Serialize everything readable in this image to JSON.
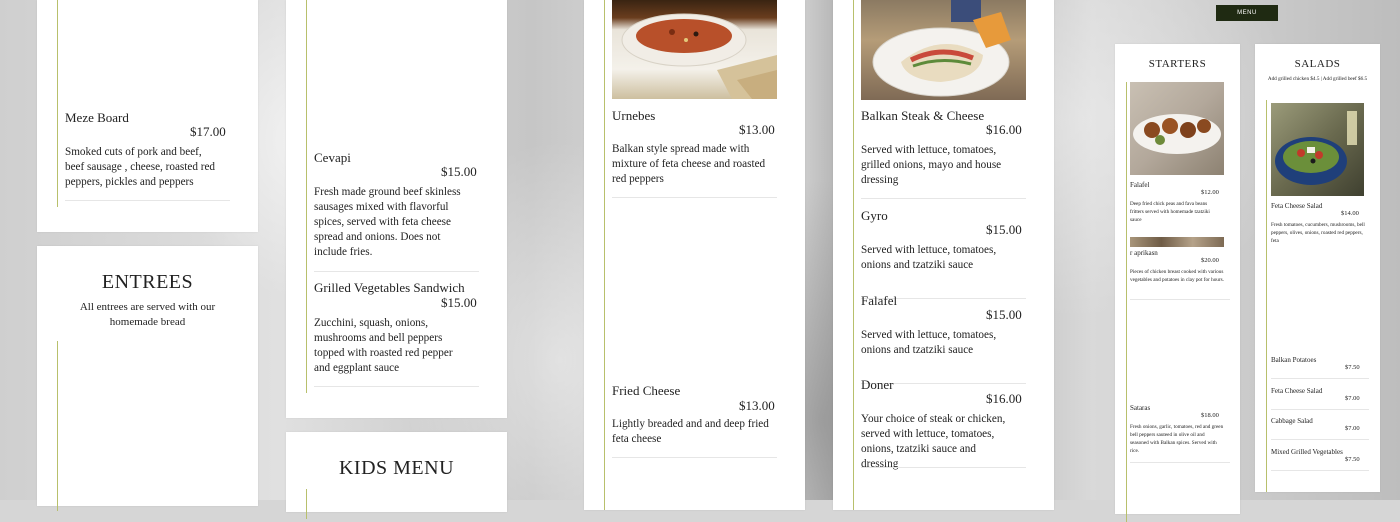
{
  "header": {
    "menu_button": "MENU"
  },
  "panel1": {
    "meze": {
      "name": "Meze Board",
      "price": "$17.00",
      "desc": "Smoked cuts of pork and beef, beef sausage , cheese, roasted red peppers, pickles and peppers"
    },
    "entrees": {
      "title": "ENTREES",
      "subtitle": "All entrees are served with our homemade bread"
    }
  },
  "panel2": {
    "cevapi": {
      "name": "Cevapi",
      "price": "$15.00",
      "desc": "Fresh made ground beef skinless sausages mixed with flavorful spices, served with feta cheese spread and onions. Does not include fries."
    },
    "grilled_veg": {
      "name": "Grilled Vegetables Sandwich",
      "price": "$15.00",
      "desc": "Zucchini, squash, onions, mushrooms and bell peppers topped with roasted red pepper and eggplant sauce"
    },
    "kids": {
      "title": "KIDS MENU"
    }
  },
  "panel3": {
    "urnebes": {
      "name": "Urnebes",
      "price": "$13.00",
      "desc": "Balkan style spread made with mixture of feta cheese and roasted red peppers"
    },
    "fried_cheese": {
      "name": "Fried Cheese",
      "price": "$13.00",
      "desc": "Lightly breaded and and deep fried feta cheese"
    }
  },
  "panel4": {
    "items": [
      {
        "name": "Balkan Steak & Cheese",
        "price": "$16.00",
        "desc": "Served with lettuce, tomatoes, grilled onions, mayo and house dressing"
      },
      {
        "name": "Gyro",
        "price": "$15.00",
        "desc": "Served with lettuce, tomatoes, onions and tzatziki sauce"
      },
      {
        "name": "Falafel",
        "price": "$15.00",
        "desc": "Served with lettuce, tomatoes, onions and tzatziki sauce"
      },
      {
        "name": "Doner",
        "price": "$16.00",
        "desc": "Your choice of steak or chicken, served with lettuce, tomatoes, onions, tzatziki sauce and dressing"
      }
    ]
  },
  "panel5": {
    "starters": {
      "title": "STARTERS",
      "falafel": {
        "name": "Falafel",
        "price": "$12.00",
        "desc": "Deep fried chick peas and fava beans fritters served with homemade tzatziki sauce"
      },
      "aprikasen": {
        "name": "r aprikasn",
        "price": "$20.00",
        "desc": "Pieces of chicken breast cooked with various vegetables and potatoes in clay pot for hours."
      },
      "sataras": {
        "name": "Sataras",
        "price": "$18.00",
        "desc": "Fresh onions, garlic, tomatoes, red and green bell peppers sauteed in olive oil and seasoned with Balkan spices. Served with rice."
      }
    },
    "salads": {
      "title": "SALADS",
      "subtitle": "Add grilled chicken $4.5 | Add grilled beef $6.5",
      "feta": {
        "name": "Feta Cheese Salad",
        "price": "$14.00",
        "desc": "Fresh tomatoes, cucumbers, mushrooms, bell peppers, olives, onions, roasted red peppers, feta"
      },
      "sides": [
        {
          "name": "Balkan Potatoes",
          "price": "$7.50"
        },
        {
          "name": "Feta Cheese Salad",
          "price": "$7.00"
        },
        {
          "name": "Cabbage Salad",
          "price": "$7.00"
        },
        {
          "name": "Mixed Grilled Vegetables",
          "price": "$7.50"
        }
      ]
    }
  }
}
